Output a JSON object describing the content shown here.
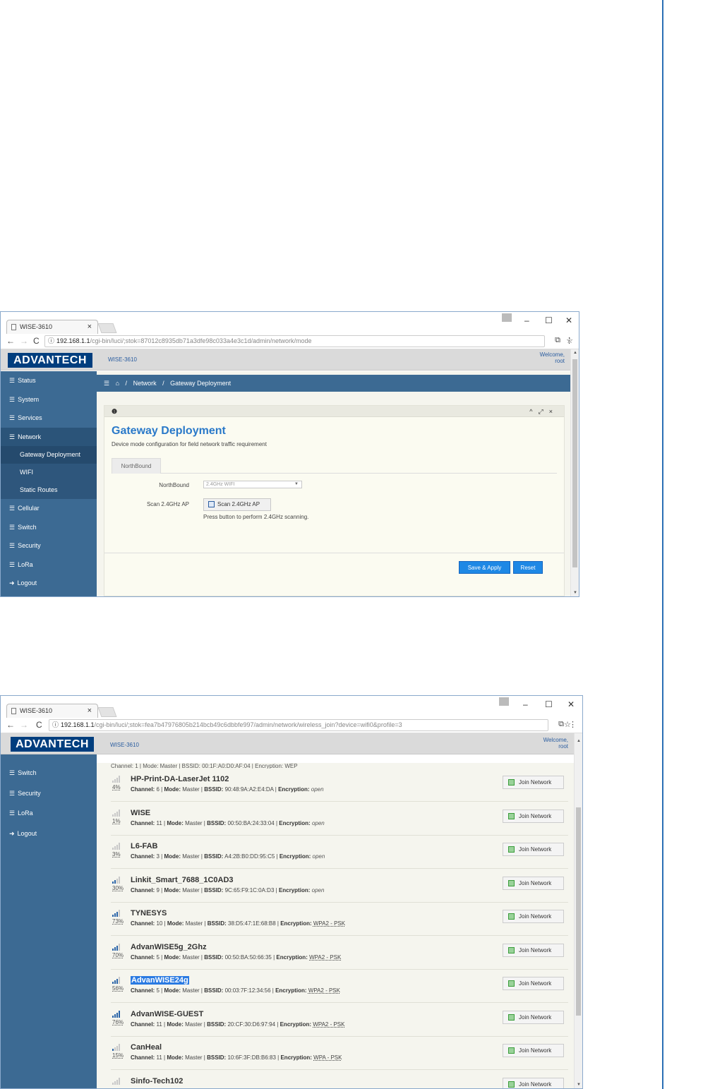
{
  "win1": {
    "tab_title": "WISE-3610",
    "url_host": "192.168.1.1",
    "url_path": "/cgi-bin/luci/;stok=87012c8935db71a3dfe98c033a4e3c1d/admin/network/mode",
    "logo": "ADVANTECH",
    "model": "WISE-3610",
    "welcome": "Welcome,",
    "user": "root",
    "sidebar": {
      "status": "Status",
      "system": "System",
      "services": "Services",
      "network": "Network",
      "gateway_deployment": "Gateway Deployment",
      "wifi": "WIFI",
      "static_routes": "Static Routes",
      "cellular": "Cellular",
      "switch": "Switch",
      "security": "Security",
      "lora": "LoRa",
      "logout": "Logout"
    },
    "breadcrumb": {
      "network": "Network",
      "current": "Gateway Deployment"
    },
    "page_title": "Gateway Deployment",
    "page_desc": "Device mode configuration for field network traffic requirement",
    "tab_northbound": "NorthBound",
    "northbound_label": "NorthBound",
    "northbound_value": "2.4GHz WIFI",
    "scan_label": "Scan 2.4GHz AP",
    "scan_button": "Scan 2.4GHz AP",
    "scan_hint": "Press button to perform 2.4GHz scanning.",
    "save_apply": "Save & Apply",
    "reset": "Reset"
  },
  "win2": {
    "tab_title": "WISE-3610",
    "url_host": "192.168.1.1",
    "url_path": "/cgi-bin/luci/;stok=fea7b47976805b214bcb49c6dbbfe997/admin/network/wireless_join?device=wifi0&profile=3",
    "logo": "ADVANTECH",
    "model": "WISE-3610",
    "welcome": "Welcome,",
    "user": "root",
    "sidebar": {
      "switch": "Switch",
      "security": "Security",
      "lora": "LoRa",
      "logout": "Logout"
    },
    "top_partial": "Channel: 1 | Mode: Master | BSSID: 00:1F:A0:D0:AF:04 | Encryption: WEP",
    "labels": {
      "channel": "Channel:",
      "mode": "Mode:",
      "bssid": "BSSID:",
      "encryption": "Encryption:",
      "join": "Join Network"
    },
    "networks": [
      {
        "ssid": "HP-Print-DA-LaserJet 1102",
        "pct": "4%",
        "bars": 0,
        "channel": "6",
        "mode": "Master",
        "bssid": "90:48:9A:A2:E4:DA",
        "enc": "open"
      },
      {
        "ssid": "WISE",
        "pct": "1%",
        "bars": 0,
        "channel": "11",
        "mode": "Master",
        "bssid": "00:50:BA:24:33:04",
        "enc": "open"
      },
      {
        "ssid": "L6-FAB",
        "pct": "3%",
        "bars": 0,
        "channel": "3",
        "mode": "Master",
        "bssid": "A4:2B:B0:DD:95:C5",
        "enc": "open"
      },
      {
        "ssid": "Linkit_Smart_7688_1C0AD3",
        "pct": "30%",
        "bars": 2,
        "channel": "9",
        "mode": "Master",
        "bssid": "9C:65:F9:1C:0A:D3",
        "enc": "open"
      },
      {
        "ssid": "TYNESYS",
        "pct": "73%",
        "bars": 3,
        "channel": "10",
        "mode": "Master",
        "bssid": "38:D5:47:1E:68:B8",
        "enc": "WPA2 - PSK"
      },
      {
        "ssid": "AdvanWISE5g_2Ghz",
        "pct": "70%",
        "bars": 3,
        "channel": "5",
        "mode": "Master",
        "bssid": "00:50:BA:50:66:35",
        "enc": "WPA2 - PSK"
      },
      {
        "ssid": "AdvanWISE24g",
        "pct": "56%",
        "bars": 3,
        "channel": "5",
        "mode": "Master",
        "bssid": "00:03:7F:12:34:56",
        "enc": "WPA2 - PSK",
        "selected": true
      },
      {
        "ssid": "AdvanWISE-GUEST",
        "pct": "76%",
        "bars": 4,
        "channel": "11",
        "mode": "Master",
        "bssid": "20:CF:30:D6:97:94",
        "enc": "WPA2 - PSK"
      },
      {
        "ssid": "CanHeal",
        "pct": "15%",
        "bars": 1,
        "channel": "11",
        "mode": "Master",
        "bssid": "10:6F:3F:DB:B6:83",
        "enc": "WPA - PSK"
      },
      {
        "ssid": "Sinfo-Tech102",
        "pct": "",
        "bars": 0,
        "channel": "",
        "mode": "",
        "bssid": "",
        "enc": ""
      }
    ]
  }
}
